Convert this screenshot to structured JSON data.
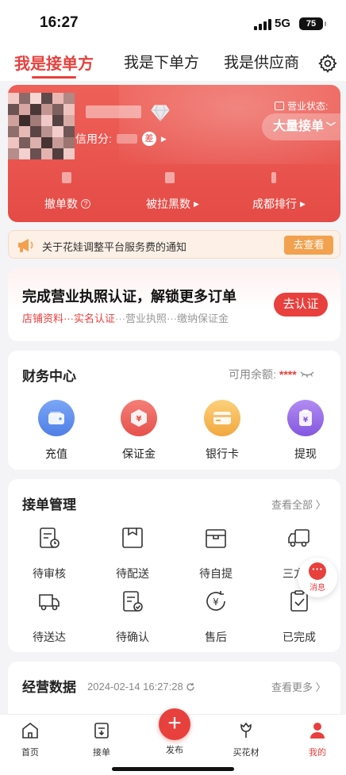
{
  "status_bar": {
    "time": "16:27",
    "network": "5G",
    "battery": "75"
  },
  "tabs": [
    {
      "label": "我是接单方",
      "active": true
    },
    {
      "label": "我是下单方",
      "active": false
    },
    {
      "label": "我是供应商",
      "active": false
    }
  ],
  "profile": {
    "credit_label": "信用分:",
    "credit_badge": "差",
    "business_status_label": "营业状态:",
    "business_status_value": "大量接单",
    "stats": [
      {
        "label": "撤单数"
      },
      {
        "label": "被拉黑数"
      },
      {
        "label": "成都排行"
      }
    ]
  },
  "notice": {
    "text": "关于花娃调整平台服务费的通知",
    "button": "去查看"
  },
  "certification": {
    "title": "完成营业执照认证，解锁更多订单",
    "button": "去认证",
    "steps": [
      "店铺资料",
      "实名认证",
      "营业执照",
      "缴纳保证金"
    ],
    "separator": "···"
  },
  "finance": {
    "title": "财务中心",
    "balance_label": "可用余额:",
    "balance_value": "****",
    "items": [
      {
        "label": "充值",
        "icon": "wallet-icon",
        "color": "#5b8def"
      },
      {
        "label": "保证金",
        "icon": "deposit-yuan-icon",
        "color": "#ee5a55"
      },
      {
        "label": "银行卡",
        "icon": "bank-card-icon",
        "color": "#f6b04a"
      },
      {
        "label": "提现",
        "icon": "withdraw-icon",
        "color": "#9a6ee8"
      }
    ]
  },
  "orders": {
    "title": "接单管理",
    "view_all": "查看全部 〉",
    "items": [
      {
        "label": "待审核",
        "icon": "pending-review-icon"
      },
      {
        "label": "待配送",
        "icon": "pending-delivery-icon"
      },
      {
        "label": "待自提",
        "icon": "pending-pickup-icon"
      },
      {
        "label": "三方配",
        "icon": "third-party-delivery-icon"
      },
      {
        "label": "待送达",
        "icon": "pending-arrival-icon"
      },
      {
        "label": "待确认",
        "icon": "pending-confirm-icon"
      },
      {
        "label": "售后",
        "icon": "after-sales-icon"
      },
      {
        "label": "已完成",
        "icon": "completed-icon"
      }
    ]
  },
  "float_message": {
    "label": "消息"
  },
  "operations": {
    "title": "经营数据",
    "datetime": "2024-02-14 16:27:28",
    "view_more": "查看更多 〉"
  },
  "bottom_nav": [
    {
      "label": "首页",
      "icon": "home-icon",
      "active": false
    },
    {
      "label": "接单",
      "icon": "receive-order-icon",
      "active": false
    },
    {
      "label": "发布",
      "icon": "plus-icon",
      "active": false
    },
    {
      "label": "买花材",
      "icon": "flower-icon",
      "active": false
    },
    {
      "label": "我的",
      "icon": "person-icon",
      "active": true
    }
  ],
  "colors": {
    "primary": "#e8403d",
    "notice_button": "#f2a14f"
  }
}
